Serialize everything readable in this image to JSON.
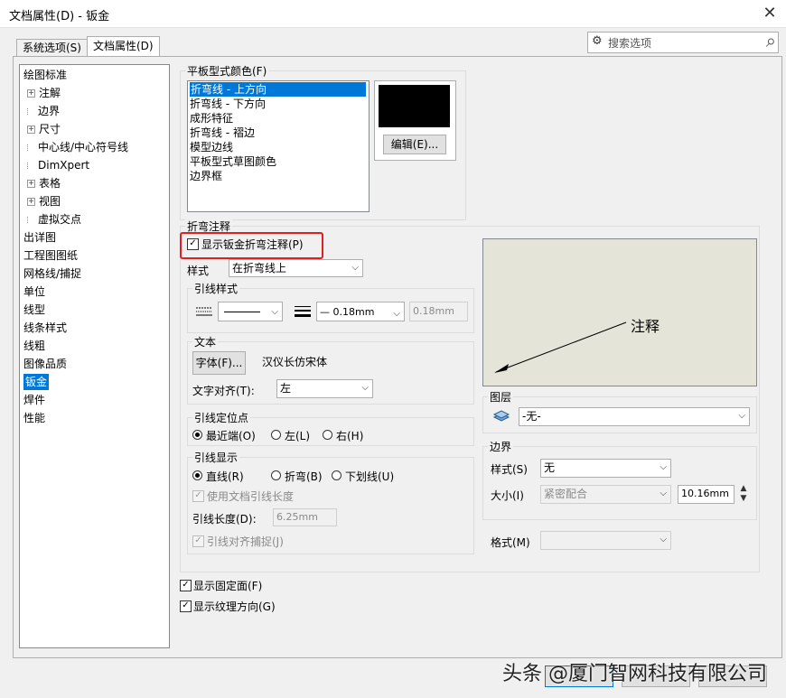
{
  "window": {
    "title": "文档属性(D) - 钣金",
    "close": "✕"
  },
  "tabs": {
    "system": "系统选项(S)",
    "document": "文档属性(D)"
  },
  "search": {
    "placeholder": "搜索选项",
    "gear": "⚙",
    "magnifier": "⌕"
  },
  "tree": [
    {
      "label": "绘图标准",
      "expand": false,
      "indent": 0
    },
    {
      "label": "注解",
      "expand": true,
      "indent": 1
    },
    {
      "label": "边界",
      "expand": false,
      "indent": 1
    },
    {
      "label": "尺寸",
      "expand": true,
      "indent": 1
    },
    {
      "label": "中心线/中心符号线",
      "expand": false,
      "indent": 1
    },
    {
      "label": "DimXpert",
      "expand": false,
      "indent": 1
    },
    {
      "label": "表格",
      "expand": true,
      "indent": 1
    },
    {
      "label": "视图",
      "expand": true,
      "indent": 1
    },
    {
      "label": "虚拟交点",
      "expand": false,
      "indent": 1
    },
    {
      "label": "出详图",
      "expand": false,
      "indent": 0
    },
    {
      "label": "工程图图纸",
      "expand": false,
      "indent": 0
    },
    {
      "label": "网格线/捕捉",
      "expand": false,
      "indent": 0
    },
    {
      "label": "单位",
      "expand": false,
      "indent": 0
    },
    {
      "label": "线型",
      "expand": false,
      "indent": 0
    },
    {
      "label": "线条样式",
      "expand": false,
      "indent": 0
    },
    {
      "label": "线粗",
      "expand": false,
      "indent": 0
    },
    {
      "label": "图像品质",
      "expand": false,
      "indent": 0
    },
    {
      "label": "钣金",
      "expand": false,
      "indent": 0,
      "selected": true
    },
    {
      "label": "焊件",
      "expand": false,
      "indent": 0
    },
    {
      "label": "性能",
      "expand": false,
      "indent": 0
    }
  ],
  "flat_colors": {
    "label": "平板型式颜色(F)",
    "items": [
      "折弯线 - 上方向",
      "折弯线 - 下方向",
      "成形特征",
      "折弯线 - 褶边",
      "模型边线",
      "平板型式草图颜色",
      "边界框"
    ],
    "selected_index": 0,
    "swatch_color": "#000000",
    "edit_button": "编辑(E)..."
  },
  "bend_notes": {
    "label": "折弯注释",
    "show_checkbox": "显示钣金折弯注释(P)",
    "style_label": "样式",
    "style_value": "在折弯线上",
    "leader_style": {
      "label": "引线样式",
      "thickness_value": "— 0.18mm",
      "thickness_custom": "0.18mm"
    },
    "text": {
      "label": "文本",
      "font_button": "字体(F)...",
      "font_name": "汉仪长仿宋体",
      "align_label": "文字对齐(T):",
      "align_value": "左"
    },
    "anchor": {
      "label": "引线定位点",
      "options": [
        "最近端(O)",
        "左(L)",
        "右(H)"
      ],
      "selected": 0
    },
    "leader_display": {
      "label": "引线显示",
      "options": [
        "直线(R)",
        "折弯(B)",
        "下划线(U)"
      ],
      "selected": 0,
      "use_doc_length": "使用文档引线长度",
      "length_label": "引线长度(D):",
      "length_value": "6.25mm",
      "snap": "引线对齐捕捉(J)"
    },
    "preview_text": "注释"
  },
  "layer": {
    "label": "图层",
    "value": "-无-"
  },
  "border": {
    "label": "边界",
    "style_label": "样式(S)",
    "style_value": "无",
    "size_label": "大小(I)",
    "size_value": "紧密配合",
    "size_number": "10.16mm"
  },
  "format": {
    "label": "格式(M)",
    "value": ""
  },
  "bottom_checks": [
    "显示固定面(F)",
    "显示纹理方向(G)"
  ],
  "watermark": "头条 @厦门智网科技有限公司"
}
